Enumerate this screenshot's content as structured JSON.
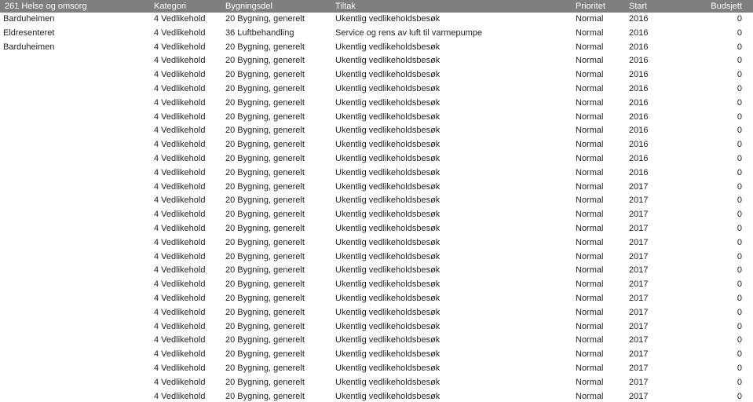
{
  "report": {
    "columns": [
      {
        "key": "navn",
        "label": "261 Helse og omsorg",
        "align": "left"
      },
      {
        "key": "kategori",
        "label": "Kategori",
        "align": "left"
      },
      {
        "key": "bygningsdel",
        "label": "Bygningsdel",
        "align": "left"
      },
      {
        "key": "tiltak",
        "label": "Tiltak",
        "align": "left"
      },
      {
        "key": "prioritet",
        "label": "Prioritet",
        "align": "left"
      },
      {
        "key": "start",
        "label": "Start",
        "align": "left"
      },
      {
        "key": "budsjett",
        "label": "Budsjett",
        "align": "right"
      }
    ],
    "header_background": "#7f7f7f",
    "header_text_color": "#ffffff",
    "body_text_color": "#231f20",
    "page_background": "#ffffff",
    "rows": [
      {
        "navn": "Barduheimen",
        "kategori": "4 Vedlikehold",
        "bygningsdel": "20 Bygning, generelt",
        "tiltak": "Ukentlig vedlikeholdsbesøk",
        "prioritet": "Normal",
        "start": "2016",
        "budsjett": "0"
      },
      {
        "navn": "Eldresenteret",
        "kategori": "4 Vedlikehold",
        "bygningsdel": "36 Luftbehandling",
        "tiltak": "Service og rens av luft til varmepumpe",
        "prioritet": "Normal",
        "start": "2016",
        "budsjett": "0"
      },
      {
        "navn": "Barduheimen",
        "kategori": "4 Vedlikehold",
        "bygningsdel": "20 Bygning, generelt",
        "tiltak": "Ukentlig vedlikeholdsbesøk",
        "prioritet": "Normal",
        "start": "2016",
        "budsjett": "0"
      },
      {
        "navn": "",
        "kategori": "4 Vedlikehold",
        "bygningsdel": "20 Bygning, generelt",
        "tiltak": "Ukentlig vedlikeholdsbesøk",
        "prioritet": "Normal",
        "start": "2016",
        "budsjett": "0"
      },
      {
        "navn": "",
        "kategori": "4 Vedlikehold",
        "bygningsdel": "20 Bygning, generelt",
        "tiltak": "Ukentlig vedlikeholdsbesøk",
        "prioritet": "Normal",
        "start": "2016",
        "budsjett": "0"
      },
      {
        "navn": "",
        "kategori": "4 Vedlikehold",
        "bygningsdel": "20 Bygning, generelt",
        "tiltak": "Ukentlig vedlikeholdsbesøk",
        "prioritet": "Normal",
        "start": "2016",
        "budsjett": "0"
      },
      {
        "navn": "",
        "kategori": "4 Vedlikehold",
        "bygningsdel": "20 Bygning, generelt",
        "tiltak": "Ukentlig vedlikeholdsbesøk",
        "prioritet": "Normal",
        "start": "2016",
        "budsjett": "0"
      },
      {
        "navn": "",
        "kategori": "4 Vedlikehold",
        "bygningsdel": "20 Bygning, generelt",
        "tiltak": "Ukentlig vedlikeholdsbesøk",
        "prioritet": "Normal",
        "start": "2016",
        "budsjett": "0"
      },
      {
        "navn": "",
        "kategori": "4 Vedlikehold",
        "bygningsdel": "20 Bygning, generelt",
        "tiltak": "Ukentlig vedlikeholdsbesøk",
        "prioritet": "Normal",
        "start": "2016",
        "budsjett": "0"
      },
      {
        "navn": "",
        "kategori": "4 Vedlikehold",
        "bygningsdel": "20 Bygning, generelt",
        "tiltak": "Ukentlig vedlikeholdsbesøk",
        "prioritet": "Normal",
        "start": "2016",
        "budsjett": "0"
      },
      {
        "navn": "",
        "kategori": "4 Vedlikehold",
        "bygningsdel": "20 Bygning, generelt",
        "tiltak": "Ukentlig vedlikeholdsbesøk",
        "prioritet": "Normal",
        "start": "2016",
        "budsjett": "0"
      },
      {
        "navn": "",
        "kategori": "4 Vedlikehold",
        "bygningsdel": "20 Bygning, generelt",
        "tiltak": "Ukentlig vedlikeholdsbesøk",
        "prioritet": "Normal",
        "start": "2016",
        "budsjett": "0"
      },
      {
        "navn": "",
        "kategori": "4 Vedlikehold",
        "bygningsdel": "20 Bygning, generelt",
        "tiltak": "Ukentlig vedlikeholdsbesøk",
        "prioritet": "Normal",
        "start": "2017",
        "budsjett": "0"
      },
      {
        "navn": "",
        "kategori": "4 Vedlikehold",
        "bygningsdel": "20 Bygning, generelt",
        "tiltak": "Ukentlig vedlikeholdsbesøk",
        "prioritet": "Normal",
        "start": "2017",
        "budsjett": "0"
      },
      {
        "navn": "",
        "kategori": "4 Vedlikehold",
        "bygningsdel": "20 Bygning, generelt",
        "tiltak": "Ukentlig vedlikeholdsbesøk",
        "prioritet": "Normal",
        "start": "2017",
        "budsjett": "0"
      },
      {
        "navn": "",
        "kategori": "4 Vedlikehold",
        "bygningsdel": "20 Bygning, generelt",
        "tiltak": "Ukentlig vedlikeholdsbesøk",
        "prioritet": "Normal",
        "start": "2017",
        "budsjett": "0"
      },
      {
        "navn": "",
        "kategori": "4 Vedlikehold",
        "bygningsdel": "20 Bygning, generelt",
        "tiltak": "Ukentlig vedlikeholdsbesøk",
        "prioritet": "Normal",
        "start": "2017",
        "budsjett": "0"
      },
      {
        "navn": "",
        "kategori": "4 Vedlikehold",
        "bygningsdel": "20 Bygning, generelt",
        "tiltak": "Ukentlig vedlikeholdsbesøk",
        "prioritet": "Normal",
        "start": "2017",
        "budsjett": "0"
      },
      {
        "navn": "",
        "kategori": "4 Vedlikehold",
        "bygningsdel": "20 Bygning, generelt",
        "tiltak": "Ukentlig vedlikeholdsbesøk",
        "prioritet": "Normal",
        "start": "2017",
        "budsjett": "0"
      },
      {
        "navn": "",
        "kategori": "4 Vedlikehold",
        "bygningsdel": "20 Bygning, generelt",
        "tiltak": "Ukentlig vedlikeholdsbesøk",
        "prioritet": "Normal",
        "start": "2017",
        "budsjett": "0"
      },
      {
        "navn": "",
        "kategori": "4 Vedlikehold",
        "bygningsdel": "20 Bygning, generelt",
        "tiltak": "Ukentlig vedlikeholdsbesøk",
        "prioritet": "Normal",
        "start": "2017",
        "budsjett": "0"
      },
      {
        "navn": "",
        "kategori": "4 Vedlikehold",
        "bygningsdel": "20 Bygning, generelt",
        "tiltak": "Ukentlig vedlikeholdsbesøk",
        "prioritet": "Normal",
        "start": "2017",
        "budsjett": "0"
      },
      {
        "navn": "",
        "kategori": "4 Vedlikehold",
        "bygningsdel": "20 Bygning, generelt",
        "tiltak": "Ukentlig vedlikeholdsbesøk",
        "prioritet": "Normal",
        "start": "2017",
        "budsjett": "0"
      },
      {
        "navn": "",
        "kategori": "4 Vedlikehold",
        "bygningsdel": "20 Bygning, generelt",
        "tiltak": "Ukentlig vedlikeholdsbesøk",
        "prioritet": "Normal",
        "start": "2017",
        "budsjett": "0"
      },
      {
        "navn": "",
        "kategori": "4 Vedlikehold",
        "bygningsdel": "20 Bygning, generelt",
        "tiltak": "Ukentlig vedlikeholdsbesøk",
        "prioritet": "Normal",
        "start": "2017",
        "budsjett": "0"
      },
      {
        "navn": "",
        "kategori": "4 Vedlikehold",
        "bygningsdel": "20 Bygning, generelt",
        "tiltak": "Ukentlig vedlikeholdsbesøk",
        "prioritet": "Normal",
        "start": "2017",
        "budsjett": "0"
      },
      {
        "navn": "",
        "kategori": "4 Vedlikehold",
        "bygningsdel": "20 Bygning, generelt",
        "tiltak": "Ukentlig vedlikeholdsbesøk",
        "prioritet": "Normal",
        "start": "2017",
        "budsjett": "0"
      },
      {
        "navn": "",
        "kategori": "4 Vedlikehold",
        "bygningsdel": "20 Bygning, generelt",
        "tiltak": "Ukentlig vedlikeholdsbesøk",
        "prioritet": "Normal",
        "start": "2017",
        "budsjett": "0"
      }
    ]
  }
}
